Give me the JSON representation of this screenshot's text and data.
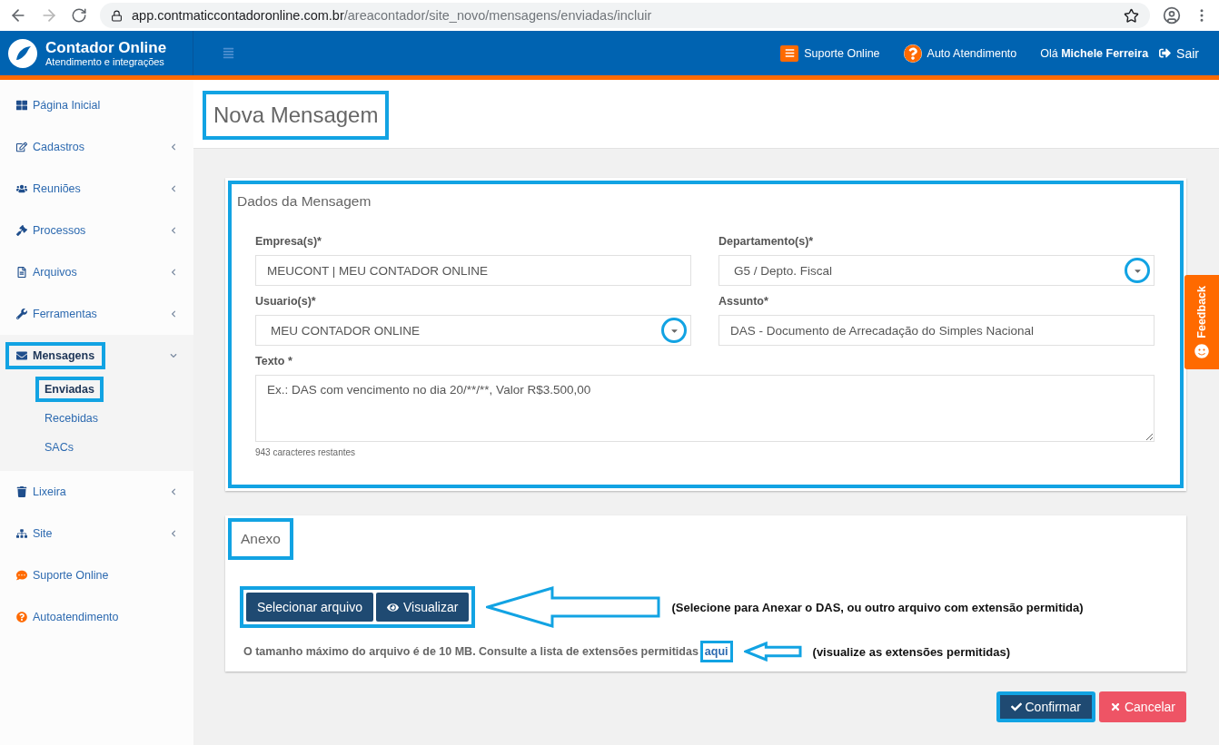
{
  "browser": {
    "url_host": "app.contmaticcontadoronline.com.br",
    "url_path": "/areacontador/site_novo/mensagens/enviadas/incluir"
  },
  "brand": {
    "title": "Contador Online",
    "subtitle": "Atendimento e integrações"
  },
  "header_links": [
    {
      "kind": "support",
      "label": "Suporte Online"
    },
    {
      "kind": "help",
      "label": "Auto Atendimento"
    }
  ],
  "user": {
    "greeting": "Olá **Michele Ferreira**"
  },
  "logout": "Sair",
  "sidebar": {
    "items": [
      {
        "label": "Página Inicial",
        "kind": "link",
        "expanded": false,
        "highlighted": false
      },
      {
        "label": "Cadastros",
        "kind": "group",
        "expanded": false,
        "highlighted": false
      },
      {
        "label": "Reuniões",
        "kind": "group",
        "expanded": false,
        "highlighted": false
      },
      {
        "label": "Processos",
        "kind": "group",
        "expanded": false,
        "highlighted": false
      },
      {
        "label": "Arquivos",
        "kind": "group",
        "expanded": false,
        "highlighted": false
      },
      {
        "label": "Ferramentas",
        "kind": "group",
        "expanded": false,
        "highlighted": false
      },
      {
        "label": "Mensagens",
        "kind": "group",
        "expanded": true,
        "highlighted": true,
        "children": [
          {
            "label": "Enviadas",
            "selected": true,
            "highlighted": true
          },
          {
            "label": "Recebidas",
            "selected": false,
            "highlighted": false
          },
          {
            "label": "SACs",
            "selected": false,
            "highlighted": false
          }
        ]
      },
      {
        "label": "Lixeira",
        "kind": "group",
        "expanded": false,
        "highlighted": false
      },
      {
        "label": "Site",
        "kind": "group",
        "expanded": false,
        "highlighted": false
      },
      {
        "label": "Suporte Online",
        "kind": "link",
        "expanded": false,
        "highlighted": false
      },
      {
        "label": "Autoatendimento",
        "kind": "link",
        "expanded": false,
        "highlighted": false
      }
    ]
  },
  "page_title": {
    "text": "Nova Mensagem",
    "highlighted": true
  },
  "message_card": {
    "title": "Dados da Mensagem",
    "highlighted": true,
    "fields": [
      {
        "kind": "text",
        "label": "Empresa(s)*",
        "value": "MEUCONT | MEU CONTADOR ONLINE"
      },
      {
        "kind": "select",
        "label": "Departamento(s)*",
        "value": "G5 / Depto. Fiscal",
        "highlighted": true
      },
      {
        "kind": "select",
        "label": "Usuario(s)*",
        "value": "MEU CONTADOR ONLINE",
        "highlighted": true
      },
      {
        "kind": "text",
        "label": "Assunto*",
        "value": "DAS - Documento de Arrecadação do Simples Nacional"
      },
      {
        "kind": "textarea",
        "label": "Texto *",
        "placeholder": "Ex.: DAS com vencimento no dia 20/**/**, Valor R$3.500,00",
        "counter": "943 caracteres restantes"
      }
    ]
  },
  "attachment_card": {
    "title": "Anexo",
    "title_highlighted": true,
    "buttons_highlighted": true,
    "buttons": [
      {
        "kind": "select",
        "label": "Selecionar arquivo"
      },
      {
        "kind": "view",
        "label": "Visualizar"
      }
    ],
    "buttons_note": "(Selecione para Anexar o DAS, ou outro arquivo com extensão permitida)",
    "info": "O tamanho máximo do arquivo é de 10 MB. Consulte a lista de extensões permitidas",
    "link": {
      "label": "aqui",
      "highlighted": true
    },
    "link_note": "(visualize as extensões permitidas)"
  },
  "actions": [
    {
      "kind": "confirm",
      "label": "Confirmar",
      "highlighted": true
    },
    {
      "kind": "cancel",
      "label": "Cancelar",
      "highlighted": false
    }
  ],
  "feedback_tab": "Feedback"
}
